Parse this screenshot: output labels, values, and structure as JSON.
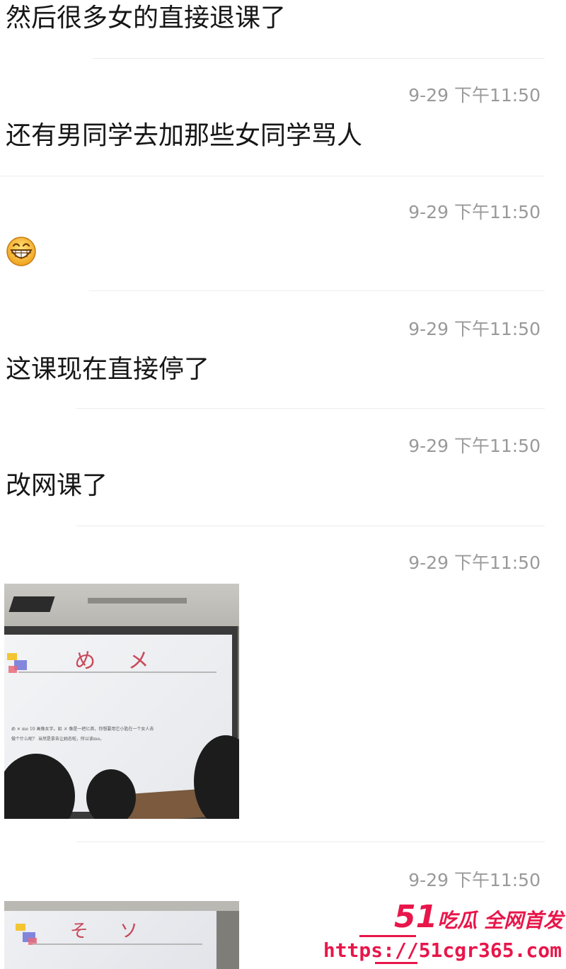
{
  "messages": [
    {
      "text": "然后很多女的直接退课了"
    },
    {
      "timestamp": "9-29 下午11:50",
      "text": "还有男同学去加那些女同学骂人"
    },
    {
      "timestamp": "9-29 下午11:50",
      "emoji": "grinning-face-emoji"
    },
    {
      "timestamp": "9-29 下午11:50",
      "text": "这课现在直接停了"
    },
    {
      "timestamp": "9-29 下午11:50",
      "text": "改网课了"
    },
    {
      "timestamp": "9-29 下午11:50",
      "image": {
        "slide_title": "め メ",
        "slide_text_1": "め ✕ me 10 画像女字。如 メ 像是一把匕首，你想要用它小匙在一个女人去",
        "slide_text_2": "做个什么呢？ 当然是拿去让她态啦，所以读me。"
      }
    },
    {
      "timestamp": "9-29 下午11:50",
      "image": {
        "slide_title": "そ ソ"
      }
    }
  ],
  "watermark": {
    "brand_number": "51",
    "brand_text": "吃瓜 全网首发",
    "url": "https://51cgr365.com",
    "color": "#e8164a"
  }
}
